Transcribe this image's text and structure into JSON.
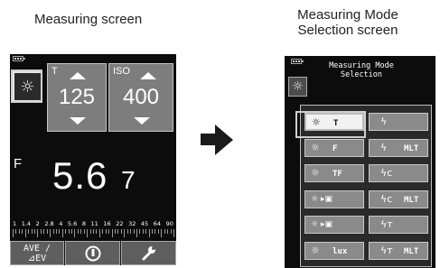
{
  "captions": {
    "left": "Measuring screen",
    "right": "Measuring Mode\nSelection screen"
  },
  "left_screen": {
    "mode_icon": "sun-icon",
    "t_label": "T",
    "t_value": "125",
    "iso_label": "ISO",
    "iso_value": "400",
    "f_label": "F",
    "f_value": "5.6",
    "f_tenths": "7",
    "scale": [
      "1",
      "1.4",
      "2",
      "2.8",
      "4",
      "5.6",
      "8",
      "11",
      "16",
      "22",
      "32",
      "45",
      "64",
      "90"
    ],
    "buttons": {
      "ave_line1": "AVE /",
      "ave_line2": "⊿EV",
      "mid_icon": "memory-icon",
      "tool_icon": "wrench-icon"
    }
  },
  "right_screen": {
    "title": "Measuring Mode\nSelection",
    "modes": [
      {
        "icon": "sun-icon",
        "label": "T",
        "selected": true
      },
      {
        "icon": "flash-icon",
        "label": ""
      },
      {
        "icon": "sun-icon",
        "label": "F"
      },
      {
        "icon": "flash-icon",
        "label": "MLT"
      },
      {
        "icon": "sun-icon",
        "label": "TF"
      },
      {
        "icon": "flash-c-icon",
        "label": ""
      },
      {
        "icon": "sun-meter-icon",
        "label": ""
      },
      {
        "icon": "flash-c-icon",
        "label": "MLT"
      },
      {
        "icon": "sun-meter-icon",
        "label": ""
      },
      {
        "icon": "flash-t-icon",
        "label": ""
      },
      {
        "icon": "sun-icon",
        "label": "lux"
      },
      {
        "icon": "flash-t-icon",
        "label": "MLT"
      }
    ]
  }
}
